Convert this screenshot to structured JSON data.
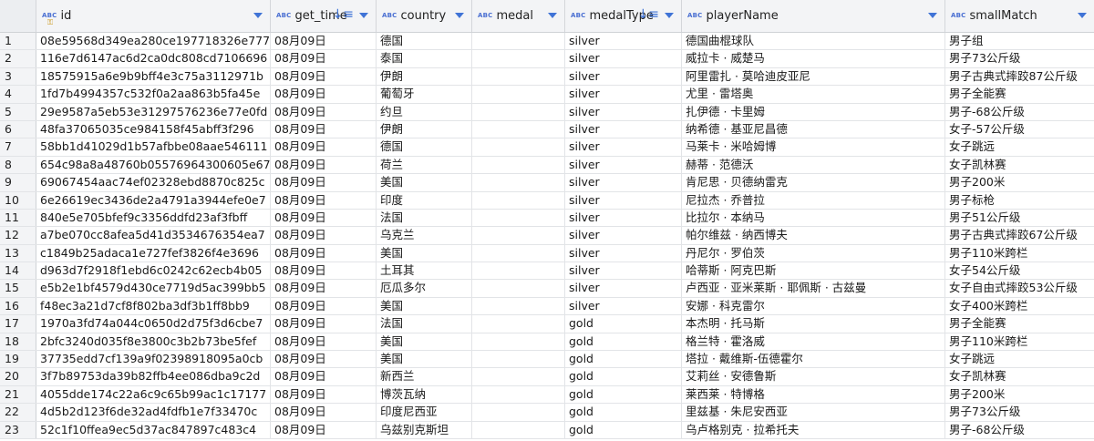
{
  "columns": [
    {
      "name": "id",
      "type_badge": "ABC",
      "key": true,
      "sort": null
    },
    {
      "name": "get_time",
      "type_badge": "ABC",
      "key": false,
      "sort": "desc"
    },
    {
      "name": "country",
      "type_badge": "ABC",
      "key": false,
      "sort": null
    },
    {
      "name": "medal",
      "type_badge": "ABC",
      "key": false,
      "sort": null
    },
    {
      "name": "medalType",
      "type_badge": "ABC",
      "key": false,
      "sort": "desc"
    },
    {
      "name": "playerName",
      "type_badge": "ABC",
      "key": false,
      "sort": null
    },
    {
      "name": "smallMatch",
      "type_badge": "ABC",
      "key": false,
      "sort": null
    }
  ],
  "rows": [
    {
      "n": "1",
      "id": "08e59568d349ea280ce197718326e777",
      "get_time": "08月09日",
      "country": "德国",
      "medal": "",
      "medalType": "silver",
      "playerName": "德国曲棍球队",
      "smallMatch": "男子组"
    },
    {
      "n": "2",
      "id": "116e7d6147ac6d2ca0dc808cd7106696",
      "get_time": "08月09日",
      "country": "泰国",
      "medal": "",
      "medalType": "silver",
      "playerName": "威拉卡 · 威楚马",
      "smallMatch": "男子73公斤级"
    },
    {
      "n": "3",
      "id": "18575915a6e9b9bff4e3c75a3112971b",
      "get_time": "08月09日",
      "country": "伊朗",
      "medal": "",
      "medalType": "silver",
      "playerName": "阿里雷扎 · 莫哈迪皮亚尼",
      "smallMatch": "男子古典式摔跤87公斤级"
    },
    {
      "n": "4",
      "id": "1fd7b4994357c532f0a2aa863b5fa45e",
      "get_time": "08月09日",
      "country": "葡萄牙",
      "medal": "",
      "medalType": "silver",
      "playerName": "尤里 · 雷塔奥",
      "smallMatch": "男子全能赛"
    },
    {
      "n": "5",
      "id": "29e9587a5eb53e31297576236e77e0fd",
      "get_time": "08月09日",
      "country": "约旦",
      "medal": "",
      "medalType": "silver",
      "playerName": "扎伊德 · 卡里姆",
      "smallMatch": "男子-68公斤级"
    },
    {
      "n": "6",
      "id": "48fa37065035ce984158f45abff3f296",
      "get_time": "08月09日",
      "country": "伊朗",
      "medal": "",
      "medalType": "silver",
      "playerName": "纳希德 · 基亚尼昌德",
      "smallMatch": "女子-57公斤级"
    },
    {
      "n": "7",
      "id": "58bb1d41029d1b57afbbe08aae546111",
      "get_time": "08月09日",
      "country": "德国",
      "medal": "",
      "medalType": "silver",
      "playerName": " 马莱卡 · 米哈姆博",
      "smallMatch": "女子跳远"
    },
    {
      "n": "8",
      "id": "654c98a8a48760b05576964300605e67",
      "get_time": "08月09日",
      "country": "荷兰",
      "medal": "",
      "medalType": "silver",
      "playerName": "赫蒂 · 范德沃",
      "smallMatch": "女子凯林赛"
    },
    {
      "n": "9",
      "id": "69067454aac74ef02328ebd8870c825c",
      "get_time": "08月09日",
      "country": "美国",
      "medal": "",
      "medalType": "silver",
      "playerName": "肯尼思 · 贝德纳雷克",
      "smallMatch": "男子200米"
    },
    {
      "n": "10",
      "id": "6e26619ec3436de2a4791a3944efe0e7",
      "get_time": "08月09日",
      "country": "印度",
      "medal": "",
      "medalType": "silver",
      "playerName": "尼拉杰 · 乔普拉",
      "smallMatch": "男子标枪"
    },
    {
      "n": "11",
      "id": "840e5e705bfef9c3356ddfd23af3fbff",
      "get_time": "08月09日",
      "country": "法国",
      "medal": "",
      "medalType": "silver",
      "playerName": "比拉尔 · 本纳马",
      "smallMatch": "男子51公斤级"
    },
    {
      "n": "12",
      "id": "a7be070cc8afea5d41d3534676354ea7",
      "get_time": "08月09日",
      "country": "乌克兰",
      "medal": "",
      "medalType": "silver",
      "playerName": "帕尔维兹 · 纳西博夫",
      "smallMatch": "男子古典式摔跤67公斤级"
    },
    {
      "n": "13",
      "id": "c1849b25adaca1e727fef3826f4e3696",
      "get_time": "08月09日",
      "country": "美国",
      "medal": "",
      "medalType": "silver",
      "playerName": "丹尼尔 · 罗伯茨",
      "smallMatch": "男子110米跨栏"
    },
    {
      "n": "14",
      "id": "d963d7f2918f1ebd6c0242c62ecb4b05",
      "get_time": "08月09日",
      "country": "土耳其",
      "medal": "",
      "medalType": "silver",
      "playerName": "哈蒂斯 · 阿克巴斯",
      "smallMatch": "女子54公斤级"
    },
    {
      "n": "15",
      "id": "e5b2e1bf4579d430ce7719d5ac399bb5",
      "get_time": "08月09日",
      "country": "厄瓜多尔",
      "medal": "",
      "medalType": "silver",
      "playerName": "卢西亚 · 亚米莱斯 · 耶佩斯 · 古兹曼",
      "smallMatch": "女子自由式摔跤53公斤级"
    },
    {
      "n": "16",
      "id": "f48ec3a21d7cf8f802ba3df3b1ff8bb9",
      "get_time": "08月09日",
      "country": "美国",
      "medal": "",
      "medalType": "silver",
      "playerName": "安娜 · 科克雷尔",
      "smallMatch": "女子400米跨栏"
    },
    {
      "n": "17",
      "id": "1970a3fd74a044c0650d2d75f3d6cbe7",
      "get_time": "08月09日",
      "country": "法国",
      "medal": "",
      "medalType": "gold",
      "playerName": "本杰明 · 托马斯",
      "smallMatch": "男子全能赛"
    },
    {
      "n": "18",
      "id": "2bfc3240d035f8e3800c3b2b73be5fef",
      "get_time": "08月09日",
      "country": "美国",
      "medal": "",
      "medalType": "gold",
      "playerName": "格兰特 · 霍洛威",
      "smallMatch": "男子110米跨栏"
    },
    {
      "n": "19",
      "id": "37735edd7cf139a9f02398918095a0cb",
      "get_time": "08月09日",
      "country": "美国",
      "medal": "",
      "medalType": "gold",
      "playerName": "塔拉 · 戴维斯-伍德霍尔",
      "smallMatch": "女子跳远"
    },
    {
      "n": "20",
      "id": "3f7b89753da39b82ffb4ee086dba9c2d",
      "get_time": "08月09日",
      "country": "新西兰",
      "medal": "",
      "medalType": "gold",
      "playerName": "艾莉丝 · 安德鲁斯",
      "smallMatch": "女子凯林赛"
    },
    {
      "n": "21",
      "id": "4055dde174c22a6c9c65b99ac1c17177",
      "get_time": "08月09日",
      "country": "博茨瓦纳",
      "medal": "",
      "medalType": "gold",
      "playerName": "莱西莱 · 特博格",
      "smallMatch": "男子200米"
    },
    {
      "n": "22",
      "id": "4d5b2d123f6de32ad4fdfb1e7f33470c",
      "get_time": "08月09日",
      "country": "印度尼西亚",
      "medal": "",
      "medalType": "gold",
      "playerName": "里兹基 · 朱尼安西亚",
      "smallMatch": "男子73公斤级"
    },
    {
      "n": "23",
      "id": "52c1f10ffea9ec5d37ac847897c483c4",
      "get_time": "08月09日",
      "country": "乌兹别克斯坦",
      "medal": "",
      "medalType": "gold",
      "playerName": "乌卢格别克 · 拉希托夫",
      "smallMatch": "男子-68公斤级"
    }
  ],
  "colors": {
    "accent": "#3f73d6",
    "header_bg": "#f3f4f6",
    "grid_line": "#e2e4e7",
    "key_icon": "#c99416"
  }
}
